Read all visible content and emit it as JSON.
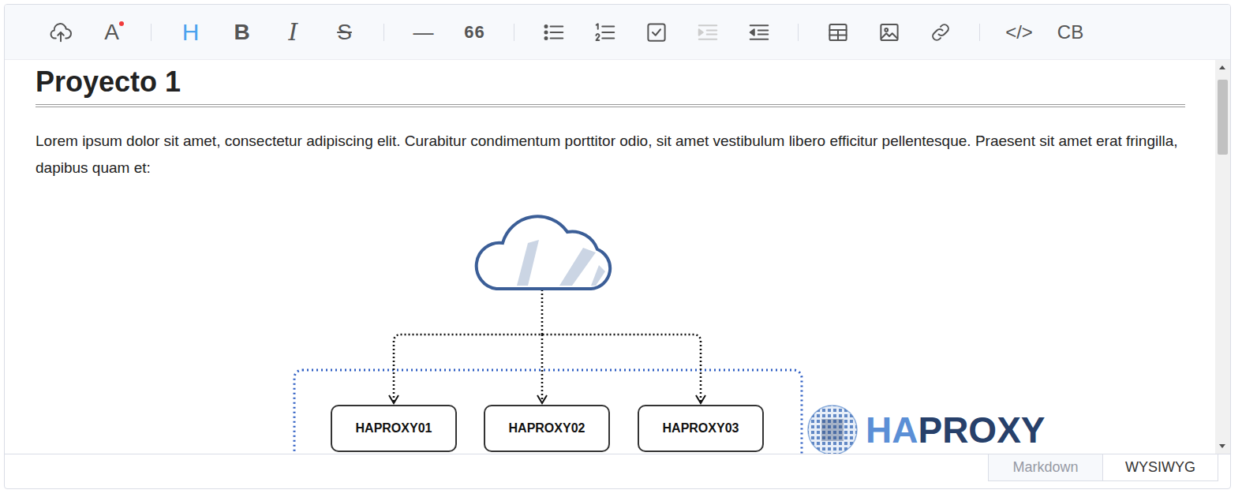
{
  "toolbar": {
    "groups": [
      [
        {
          "kind": "icon",
          "active": false,
          "disabled": false
        },
        {
          "kind": "glyph",
          "glyph": "A",
          "active": false,
          "disabled": false
        }
      ],
      [
        {
          "kind": "glyph",
          "glyph": "H",
          "active": true,
          "disabled": false
        },
        {
          "kind": "glyph",
          "glyph": "B",
          "active": false,
          "disabled": false
        },
        {
          "kind": "glyph",
          "glyph": "I",
          "active": false,
          "disabled": false
        },
        {
          "kind": "glyph",
          "glyph": "S",
          "active": false,
          "disabled": false
        }
      ],
      [
        {
          "kind": "glyph",
          "glyph": "—",
          "active": false,
          "disabled": false
        },
        {
          "kind": "glyph",
          "glyph": "66",
          "active": false,
          "disabled": false
        }
      ],
      [
        {
          "kind": "icon",
          "active": false,
          "disabled": false
        },
        {
          "kind": "icon",
          "active": false,
          "disabled": false
        },
        {
          "kind": "icon",
          "active": false,
          "disabled": false
        },
        {
          "kind": "icon",
          "active": false,
          "disabled": true
        },
        {
          "kind": "icon",
          "active": false,
          "disabled": false
        }
      ],
      [
        {
          "kind": "icon",
          "active": false,
          "disabled": false
        },
        {
          "kind": "icon",
          "active": false,
          "disabled": false
        },
        {
          "kind": "icon",
          "active": false,
          "disabled": false
        }
      ],
      [
        {
          "kind": "glyph",
          "glyph": "</>",
          "active": false,
          "disabled": false
        },
        {
          "kind": "glyph",
          "glyph": "CB",
          "active": false,
          "disabled": false
        }
      ]
    ]
  },
  "document": {
    "heading": "Proyecto 1",
    "paragraph": "Lorem ipsum dolor sit amet, consectetur adipiscing elit. Curabitur condimentum porttitor odio, sit amet vestibulum libero efficitur pellentesque. Praesent sit amet erat fringilla, dapibus quam et:",
    "diagram": {
      "nodes": [
        {
          "label": "HAPROXY01"
        },
        {
          "label": "HAPROXY02"
        },
        {
          "label": "HAPROXY03"
        }
      ],
      "logo": [
        {
          "text": "HA",
          "color": "#5b8fd6"
        },
        {
          "text": "PROXY",
          "color": "#27406a"
        }
      ]
    }
  },
  "mode_tabs": [
    {
      "label": "Markdown",
      "selected": false
    },
    {
      "label": "WYSIWYG",
      "selected": true
    }
  ]
}
